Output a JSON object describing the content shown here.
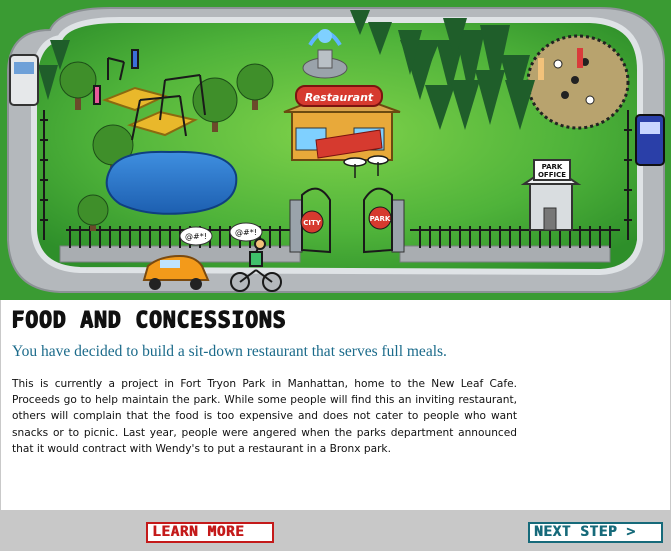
{
  "scene": {
    "restaurant_sign": "Restaurant",
    "office_sign_line1": "PARK",
    "office_sign_line2": "OFFICE",
    "gate_left_sign": "CITY",
    "gate_right_sign": "PARK",
    "speech_bubble_1": "@#*!",
    "speech_bubble_2": "@#*!"
  },
  "content": {
    "title": "FOOD AND CONCESSIONS",
    "subtitle": "You have decided to build a sit-down restaurant that serves full meals.",
    "body": "This is currently a project in Fort Tryon Park in Manhattan, home to the New Leaf Cafe. Proceeds go to help maintain the park. While some people will find this an inviting restaurant, others will complain that the food is too expensive and does not cater to people who want snacks or to picnic. Last year, people were angered when the parks department announced that it would contract with Wendy's to put a restaurant in a Bronx park."
  },
  "footer": {
    "learn_more_label": "LEARN MORE",
    "next_step_label": "NEXT STEP >"
  },
  "colors": {
    "grass": "#3fa535",
    "road": "#b4b8bc",
    "subtitle": "#1a6a8a",
    "learn_more": "#c41a1a",
    "next_step": "#166a7a"
  }
}
